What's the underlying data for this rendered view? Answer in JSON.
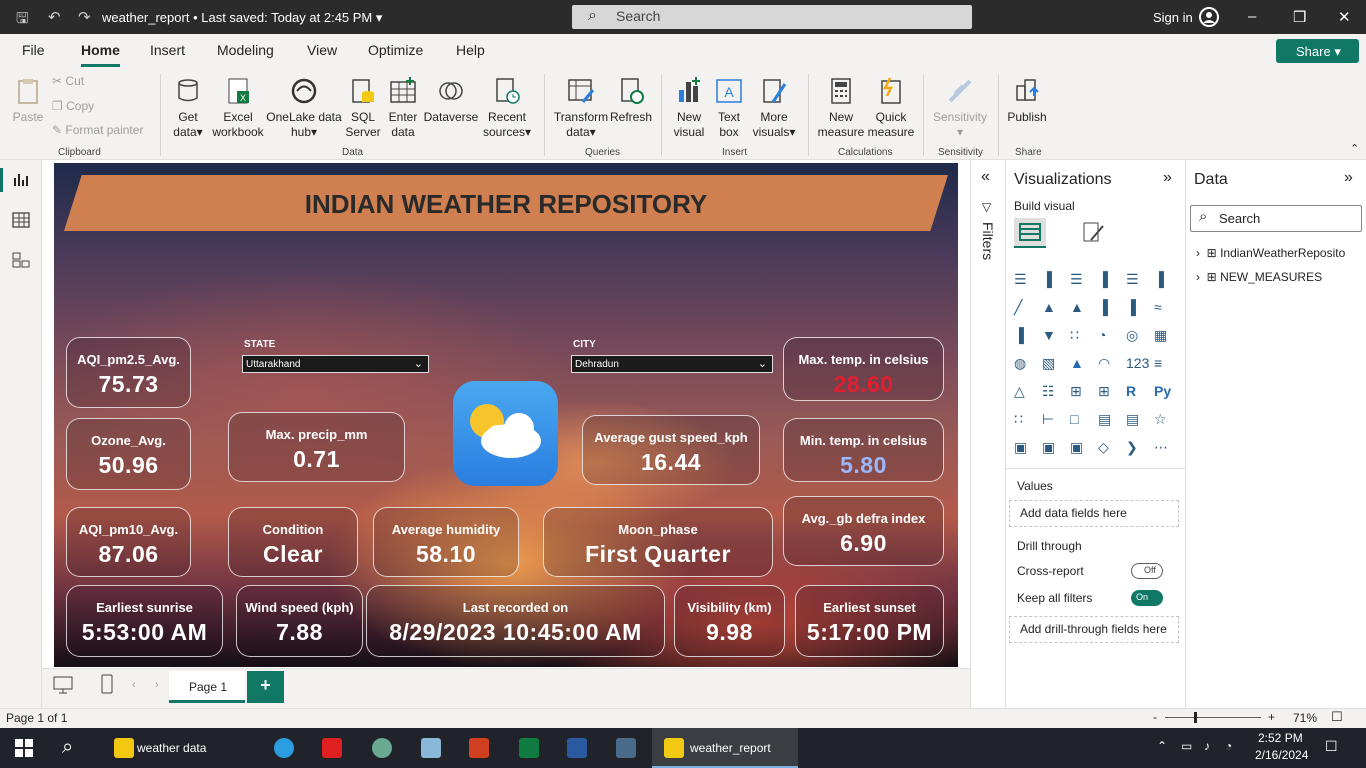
{
  "titlebar": {
    "filename": "weather_report",
    "saved": "Last saved: Today at 2:45 PM",
    "search": "Search",
    "signin": "Sign in"
  },
  "menu": {
    "file": "File",
    "home": "Home",
    "insert": "Insert",
    "modeling": "Modeling",
    "view": "View",
    "optimize": "Optimize",
    "help": "Help",
    "share": "Share"
  },
  "ribbon": {
    "paste": "Paste",
    "cut": "Cut",
    "copy": "Copy",
    "format_painter": "Format painter",
    "clipboard": "Clipboard",
    "get_data": [
      "Get",
      "data"
    ],
    "excel": [
      "Excel",
      "workbook"
    ],
    "onelake": [
      "OneLake data",
      "hub"
    ],
    "sql": [
      "SQL",
      "Server"
    ],
    "enter_data": [
      "Enter",
      "data"
    ],
    "dataverse": "Dataverse",
    "recent": [
      "Recent",
      "sources"
    ],
    "data_group": "Data",
    "transform": [
      "Transform",
      "data"
    ],
    "refresh": "Refresh",
    "queries": "Queries",
    "new_visual": [
      "New",
      "visual"
    ],
    "text_box": [
      "Text",
      "box"
    ],
    "more_visuals": [
      "More",
      "visuals"
    ],
    "insert_group": "Insert",
    "new_measure": [
      "New",
      "measure"
    ],
    "quick_measure": [
      "Quick",
      "measure"
    ],
    "calculations": "Calculations",
    "sensitivity": "Sensitivity",
    "sensitivity_group": "Sensitivity",
    "publish": "Publish",
    "share_group": "Share"
  },
  "report": {
    "title": "INDIAN WEATHER REPOSITORY",
    "state_label": "STATE",
    "state_value": "Uttarakhand",
    "city_label": "CITY",
    "city_value": "Dehradun",
    "cards": [
      {
        "label": "AQI_pm2.5_Avg.",
        "value": "75.73"
      },
      {
        "label": "Ozone_Avg.",
        "value": "50.96"
      },
      {
        "label": "AQI_pm10_Avg.",
        "value": "87.06"
      },
      {
        "label": "Max. precip_mm",
        "value": "0.71"
      },
      {
        "label": "Average gust speed_kph",
        "value": "16.44"
      },
      {
        "label": "Max. temp. in celsius",
        "value": "28.60"
      },
      {
        "label": "Min. temp. in celsius",
        "value": "5.80"
      },
      {
        "label": "Condition",
        "value": "Clear"
      },
      {
        "label": "Average humidity",
        "value": "58.10"
      },
      {
        "label": "Moon_phase",
        "value": "First Quarter"
      },
      {
        "label": "Avg._gb defra index",
        "value": "6.90"
      },
      {
        "label": "Earliest sunrise",
        "value": "5:53:00 AM"
      },
      {
        "label": "Wind speed (kph)",
        "value": "7.88"
      },
      {
        "label": "Last recorded on",
        "value": "8/29/2023 10:45:00 AM"
      },
      {
        "label": "Visibility (km)",
        "value": "9.98"
      },
      {
        "label": "Earliest sunset",
        "value": "5:17:00 PM"
      }
    ],
    "colors": {
      "max_temp": "#e02030",
      "min_temp": "#9ab8ff",
      "banner": "#d08050"
    }
  },
  "filters": {
    "label": "Filters"
  },
  "viz": {
    "title": "Visualizations",
    "build": "Build visual",
    "values": "Values",
    "add_data": "Add data fields here",
    "drill": "Drill through",
    "cross": "Cross-report",
    "cross_state": "Off",
    "keep": "Keep all filters",
    "keep_state": "On",
    "add_drill": "Add drill-through fields here"
  },
  "datapane": {
    "title": "Data",
    "search": "Search",
    "tables": [
      "IndianWeatherReposito",
      "NEW_MEASURES"
    ]
  },
  "pages": {
    "tab": "Page 1",
    "add": "+"
  },
  "status": {
    "page": "Page 1 of 1",
    "zoom": "71%"
  },
  "taskbar": {
    "weather_data": "weather data",
    "weather_report": "weather_report",
    "time": "2:52 PM",
    "date": "2/16/2024"
  }
}
